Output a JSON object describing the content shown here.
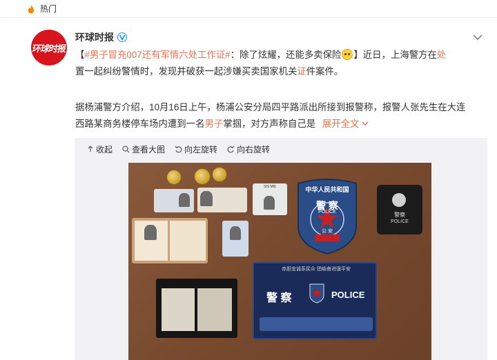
{
  "topbar": {
    "label": "热门"
  },
  "account": {
    "avatar_text": "环球时报",
    "name": "环球时报"
  },
  "post": {
    "line1": {
      "open_bracket": "【",
      "topic": "#男子冒充007还有军情六处工作证#",
      "rest1": "：除了炫耀，还能多卖保险",
      "close_and_text": "】近日，上海警方在",
      "hl1": "处"
    },
    "line2": {
      "text1": "置一起纠纷警情时，发现并破获一起涉嫌买卖国家机关",
      "hl2": "证",
      "text2": "件案件。"
    },
    "line3": {
      "text": "据杨浦警方介绍，10月16日上午，杨浦公安分局四平路派出所接到报警称，报警人张先生在大连"
    },
    "line4": {
      "text1": "西路某商务楼停车场内遭到一名",
      "hl3": "男子",
      "text2": "掌掴，对方声称自己是",
      "expand": "展开全文"
    }
  },
  "media_toolbar": {
    "collapse": "收起",
    "view_large": "查看大图",
    "rotate_left": "向左旋转",
    "rotate_right": "向右旋转"
  },
  "photo": {
    "patch_top": "中华人民共和国",
    "patch_mid": "警 察",
    "patch_police": "POLICE",
    "patch_ministry": "公 安",
    "plate_top": "赤胆忠诚系民众 团结奋进强平安",
    "plate_jingcha": "警 察",
    "plate_police": "POLICE",
    "wallet_police": "POLICE",
    "wallet_jingcha": "警察",
    "sis_label": "SIS MI6"
  },
  "colors": {
    "accent": "#eb7350",
    "brand": "#d8141c",
    "verified": "#1e90ff"
  }
}
